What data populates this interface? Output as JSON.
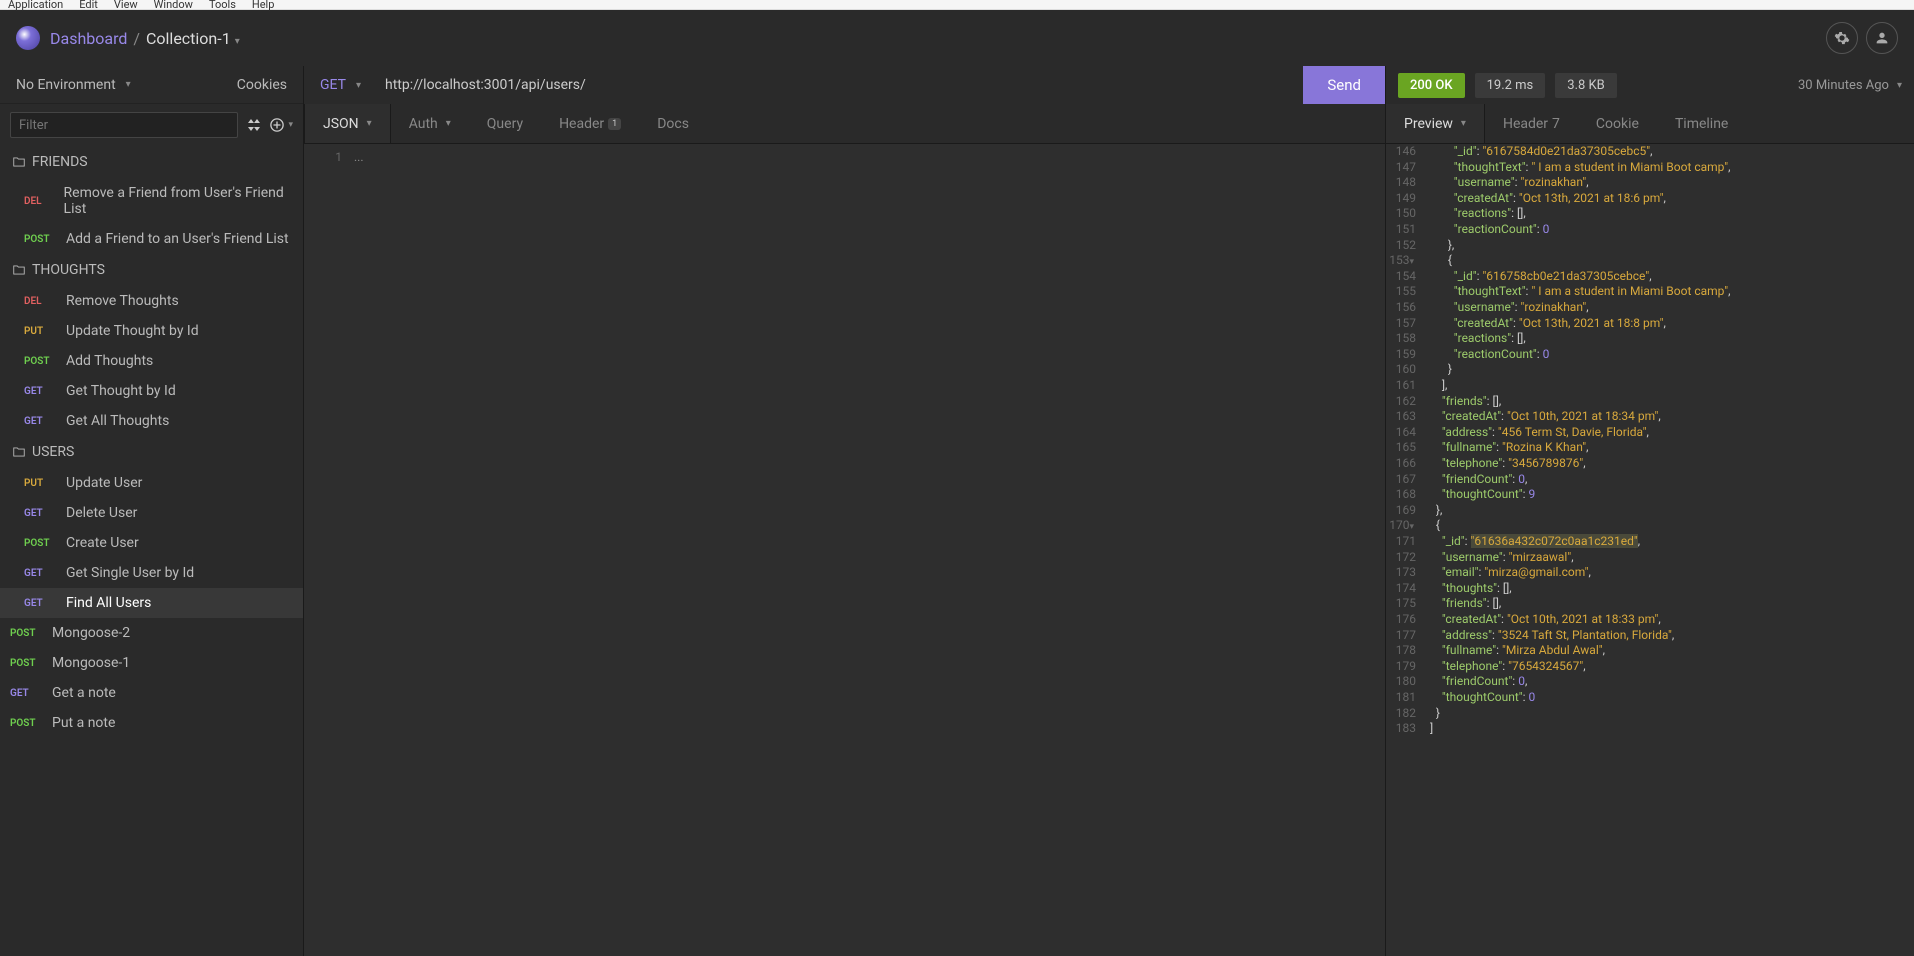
{
  "menubar": [
    "Application",
    "Edit",
    "View",
    "Window",
    "Tools",
    "Help"
  ],
  "breadcrumb": {
    "dashboard": "Dashboard",
    "sep": "/",
    "collection": "Collection-1"
  },
  "sidebar": {
    "environment": "No Environment",
    "cookies_label": "Cookies",
    "filter_placeholder": "Filter",
    "folders": [
      {
        "name": "FRIENDS",
        "requests": [
          {
            "method": "DEL",
            "name": "Remove a Friend from User's Friend List"
          },
          {
            "method": "POST",
            "name": "Add a Friend to an User's Friend List"
          }
        ]
      },
      {
        "name": "THOUGHTS",
        "requests": [
          {
            "method": "DEL",
            "name": "Remove Thoughts"
          },
          {
            "method": "PUT",
            "name": "Update Thought by Id"
          },
          {
            "method": "POST",
            "name": "Add Thoughts"
          },
          {
            "method": "GET",
            "name": "Get Thought by Id"
          },
          {
            "method": "GET",
            "name": "Get All Thoughts"
          }
        ]
      },
      {
        "name": "USERS",
        "requests": [
          {
            "method": "PUT",
            "name": "Update User"
          },
          {
            "method": "GET",
            "name": "Delete User"
          },
          {
            "method": "POST",
            "name": "Create User"
          },
          {
            "method": "GET",
            "name": "Get Single User by Id"
          },
          {
            "method": "GET",
            "name": "Find All Users",
            "active": true
          }
        ]
      }
    ],
    "root_requests": [
      {
        "method": "POST",
        "name": "Mongoose-2"
      },
      {
        "method": "POST",
        "name": "Mongoose-1"
      },
      {
        "method": "GET",
        "name": "Get a note"
      },
      {
        "method": "POST",
        "name": "Put a note"
      }
    ]
  },
  "request": {
    "method": "GET",
    "url": "http://localhost:3001/api/users/",
    "send_label": "Send",
    "tabs": {
      "json": "JSON",
      "auth": "Auth",
      "query": "Query",
      "header": "Header",
      "header_badge": "1",
      "docs": "Docs"
    },
    "body_lines": [
      {
        "n": "1",
        "c": "..."
      }
    ]
  },
  "response": {
    "status": "200 OK",
    "time": "19.2 ms",
    "size": "3.8 KB",
    "age": "30 Minutes Ago",
    "tabs": {
      "preview": "Preview",
      "header": "Header",
      "header_badge": "7",
      "cookie": "Cookie",
      "timeline": "Timeline"
    },
    "lines": [
      {
        "n": "146",
        "indent": 5,
        "tokens": [
          [
            "k",
            "\"_id\""
          ],
          [
            "p",
            ": "
          ],
          [
            "s",
            "\"6167584d0e21da37305cebc5\""
          ],
          [
            "p",
            ","
          ]
        ]
      },
      {
        "n": "147",
        "indent": 5,
        "tokens": [
          [
            "k",
            "\"thoughtText\""
          ],
          [
            "p",
            ": "
          ],
          [
            "s",
            "\" I am a student in Miami Boot camp\""
          ],
          [
            "p",
            ","
          ]
        ]
      },
      {
        "n": "148",
        "indent": 5,
        "tokens": [
          [
            "k",
            "\"username\""
          ],
          [
            "p",
            ": "
          ],
          [
            "s",
            "\"rozinakhan\""
          ],
          [
            "p",
            ","
          ]
        ]
      },
      {
        "n": "149",
        "indent": 5,
        "tokens": [
          [
            "k",
            "\"createdAt\""
          ],
          [
            "p",
            ": "
          ],
          [
            "s",
            "\"Oct 13th, 2021 at 18:6 pm\""
          ],
          [
            "p",
            ","
          ]
        ]
      },
      {
        "n": "150",
        "indent": 5,
        "tokens": [
          [
            "k",
            "\"reactions\""
          ],
          [
            "p",
            ": [],"
          ]
        ]
      },
      {
        "n": "151",
        "indent": 5,
        "tokens": [
          [
            "k",
            "\"reactionCount\""
          ],
          [
            "p",
            ": "
          ],
          [
            "n",
            "0"
          ]
        ]
      },
      {
        "n": "152",
        "indent": 4,
        "tokens": [
          [
            "p",
            "},"
          ]
        ]
      },
      {
        "n": "153",
        "indent": 4,
        "fold": true,
        "tokens": [
          [
            "p",
            "{"
          ]
        ]
      },
      {
        "n": "154",
        "indent": 5,
        "tokens": [
          [
            "k",
            "\"_id\""
          ],
          [
            "p",
            ": "
          ],
          [
            "s",
            "\"616758cb0e21da37305cebce\""
          ],
          [
            "p",
            ","
          ]
        ]
      },
      {
        "n": "155",
        "indent": 5,
        "tokens": [
          [
            "k",
            "\"thoughtText\""
          ],
          [
            "p",
            ": "
          ],
          [
            "s",
            "\" I am a student in Miami Boot camp\""
          ],
          [
            "p",
            ","
          ]
        ]
      },
      {
        "n": "156",
        "indent": 5,
        "tokens": [
          [
            "k",
            "\"username\""
          ],
          [
            "p",
            ": "
          ],
          [
            "s",
            "\"rozinakhan\""
          ],
          [
            "p",
            ","
          ]
        ]
      },
      {
        "n": "157",
        "indent": 5,
        "tokens": [
          [
            "k",
            "\"createdAt\""
          ],
          [
            "p",
            ": "
          ],
          [
            "s",
            "\"Oct 13th, 2021 at 18:8 pm\""
          ],
          [
            "p",
            ","
          ]
        ]
      },
      {
        "n": "158",
        "indent": 5,
        "tokens": [
          [
            "k",
            "\"reactions\""
          ],
          [
            "p",
            ": [],"
          ]
        ]
      },
      {
        "n": "159",
        "indent": 5,
        "tokens": [
          [
            "k",
            "\"reactionCount\""
          ],
          [
            "p",
            ": "
          ],
          [
            "n",
            "0"
          ]
        ]
      },
      {
        "n": "160",
        "indent": 4,
        "tokens": [
          [
            "p",
            "}"
          ]
        ]
      },
      {
        "n": "161",
        "indent": 3,
        "tokens": [
          [
            "p",
            "],"
          ]
        ]
      },
      {
        "n": "162",
        "indent": 3,
        "tokens": [
          [
            "k",
            "\"friends\""
          ],
          [
            "p",
            ": [],"
          ]
        ]
      },
      {
        "n": "163",
        "indent": 3,
        "tokens": [
          [
            "k",
            "\"createdAt\""
          ],
          [
            "p",
            ": "
          ],
          [
            "s",
            "\"Oct 10th, 2021 at 18:34 pm\""
          ],
          [
            "p",
            ","
          ]
        ]
      },
      {
        "n": "164",
        "indent": 3,
        "tokens": [
          [
            "k",
            "\"address\""
          ],
          [
            "p",
            ": "
          ],
          [
            "s",
            "\"456 Term St, Davie, Florida\""
          ],
          [
            "p",
            ","
          ]
        ]
      },
      {
        "n": "165",
        "indent": 3,
        "tokens": [
          [
            "k",
            "\"fullname\""
          ],
          [
            "p",
            ": "
          ],
          [
            "s",
            "\"Rozina K Khan\""
          ],
          [
            "p",
            ","
          ]
        ]
      },
      {
        "n": "166",
        "indent": 3,
        "tokens": [
          [
            "k",
            "\"telephone\""
          ],
          [
            "p",
            ": "
          ],
          [
            "s",
            "\"3456789876\""
          ],
          [
            "p",
            ","
          ]
        ]
      },
      {
        "n": "167",
        "indent": 3,
        "tokens": [
          [
            "k",
            "\"friendCount\""
          ],
          [
            "p",
            ": "
          ],
          [
            "n",
            "0"
          ],
          [
            "p",
            ","
          ]
        ]
      },
      {
        "n": "168",
        "indent": 3,
        "tokens": [
          [
            "k",
            "\"thoughtCount\""
          ],
          [
            "p",
            ": "
          ],
          [
            "n",
            "9"
          ]
        ]
      },
      {
        "n": "169",
        "indent": 2,
        "tokens": [
          [
            "p",
            "},"
          ]
        ]
      },
      {
        "n": "170",
        "indent": 2,
        "fold": true,
        "tokens": [
          [
            "p",
            "{"
          ]
        ]
      },
      {
        "n": "171",
        "indent": 3,
        "tokens": [
          [
            "k",
            "\"_id\""
          ],
          [
            "p",
            ": "
          ],
          [
            "s",
            "\"61636a432c072c0aa1c231ed\""
          ],
          [
            "p",
            ","
          ]
        ],
        "hl_s": true
      },
      {
        "n": "172",
        "indent": 3,
        "tokens": [
          [
            "k",
            "\"username\""
          ],
          [
            "p",
            ": "
          ],
          [
            "s",
            "\"mirzaawal\""
          ],
          [
            "p",
            ","
          ]
        ]
      },
      {
        "n": "173",
        "indent": 3,
        "tokens": [
          [
            "k",
            "\"email\""
          ],
          [
            "p",
            ": "
          ],
          [
            "s",
            "\"mirza@gmail.com\""
          ],
          [
            "p",
            ","
          ]
        ]
      },
      {
        "n": "174",
        "indent": 3,
        "tokens": [
          [
            "k",
            "\"thoughts\""
          ],
          [
            "p",
            ": [],"
          ]
        ]
      },
      {
        "n": "175",
        "indent": 3,
        "tokens": [
          [
            "k",
            "\"friends\""
          ],
          [
            "p",
            ": [],"
          ]
        ]
      },
      {
        "n": "176",
        "indent": 3,
        "tokens": [
          [
            "k",
            "\"createdAt\""
          ],
          [
            "p",
            ": "
          ],
          [
            "s",
            "\"Oct 10th, 2021 at 18:33 pm\""
          ],
          [
            "p",
            ","
          ]
        ]
      },
      {
        "n": "177",
        "indent": 3,
        "tokens": [
          [
            "k",
            "\"address\""
          ],
          [
            "p",
            ": "
          ],
          [
            "s",
            "\"3524 Taft St, Plantation, Florida\""
          ],
          [
            "p",
            ","
          ]
        ]
      },
      {
        "n": "178",
        "indent": 3,
        "tokens": [
          [
            "k",
            "\"fullname\""
          ],
          [
            "p",
            ": "
          ],
          [
            "s",
            "\"Mirza Abdul Awal\""
          ],
          [
            "p",
            ","
          ]
        ]
      },
      {
        "n": "179",
        "indent": 3,
        "tokens": [
          [
            "k",
            "\"telephone\""
          ],
          [
            "p",
            ": "
          ],
          [
            "s",
            "\"7654324567\""
          ],
          [
            "p",
            ","
          ]
        ]
      },
      {
        "n": "180",
        "indent": 3,
        "tokens": [
          [
            "k",
            "\"friendCount\""
          ],
          [
            "p",
            ": "
          ],
          [
            "n",
            "0"
          ],
          [
            "p",
            ","
          ]
        ]
      },
      {
        "n": "181",
        "indent": 3,
        "tokens": [
          [
            "k",
            "\"thoughtCount\""
          ],
          [
            "p",
            ": "
          ],
          [
            "n",
            "0"
          ]
        ]
      },
      {
        "n": "182",
        "indent": 2,
        "tokens": [
          [
            "p",
            "}"
          ]
        ]
      },
      {
        "n": "183",
        "indent": 1,
        "tokens": [
          [
            "p",
            "]"
          ]
        ]
      }
    ]
  }
}
